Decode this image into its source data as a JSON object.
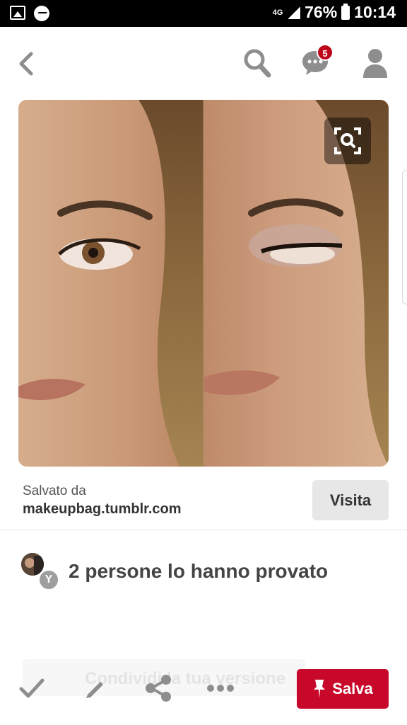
{
  "status_bar": {
    "network": "4G",
    "battery": "76%",
    "time": "10:14"
  },
  "header": {
    "notifications_count": "5"
  },
  "pin": {
    "image_alt": "Before and after eye makeup",
    "source_label": "Salvato da",
    "source_domain": "makeupbag.tumblr.com",
    "visit_label": "Visita"
  },
  "tried": {
    "avatar_letter": "Y",
    "text": "2 persone lo hanno provato"
  },
  "bottom_bar": {
    "ghost_text": "Condividi la tua versione",
    "save_label": "Salva"
  },
  "colors": {
    "accent": "#c8082a",
    "badge": "#bd081c",
    "icon_gray": "#8e8e8e"
  }
}
